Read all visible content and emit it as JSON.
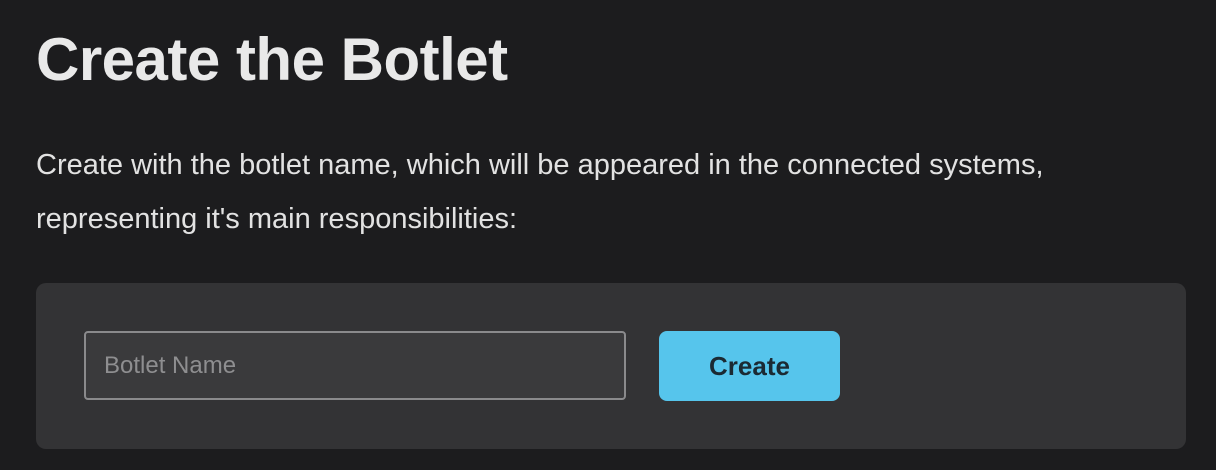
{
  "header": {
    "title": "Create the Botlet"
  },
  "description": "Create with the botlet name, which will be appeared in the connected systems, representing it's main responsibilities:",
  "form": {
    "name_value": "",
    "name_placeholder": "Botlet Name",
    "create_label": "Create"
  },
  "colors": {
    "background": "#1c1c1e",
    "panel": "#333335",
    "accent": "#56c5ec"
  }
}
